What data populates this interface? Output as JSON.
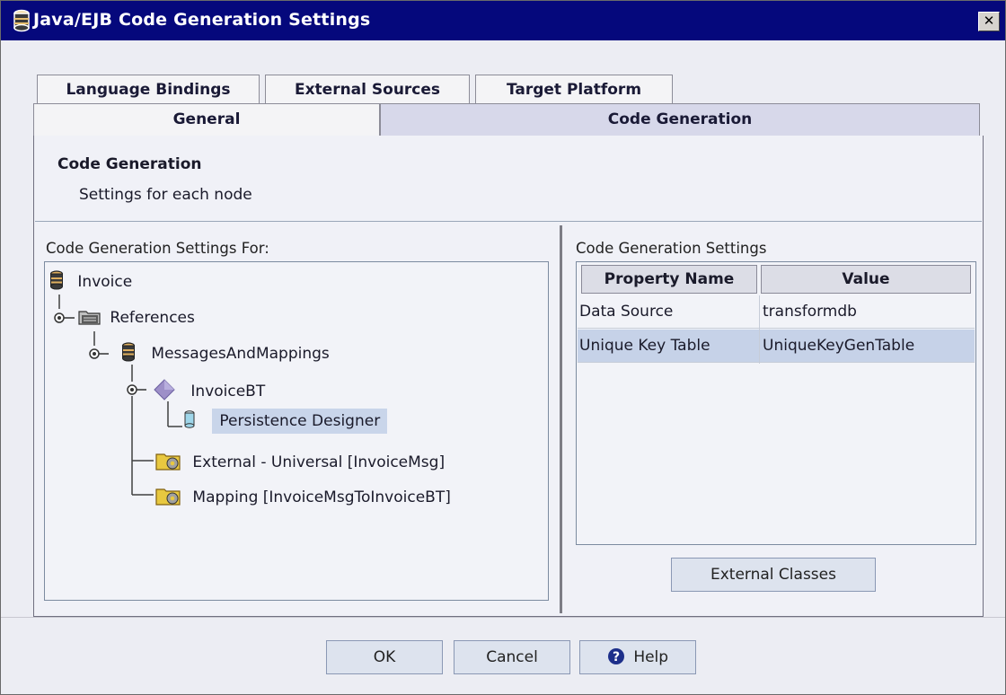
{
  "window": {
    "title": "Java/EJB Code Generation Settings",
    "close_glyph": "✕"
  },
  "tabs": {
    "row_back": [
      {
        "label": "Language Bindings"
      },
      {
        "label": "External Sources"
      },
      {
        "label": "Target Platform"
      }
    ],
    "row_front": [
      {
        "label": "General",
        "active": false
      },
      {
        "label": "Code Generation",
        "active": true
      }
    ]
  },
  "header": {
    "title": "Code Generation",
    "subtitle": "Settings for each node"
  },
  "tree_panel": {
    "label": "Code Generation Settings For:",
    "items": [
      {
        "label": "Invoice",
        "icon": "database-icon"
      },
      {
        "label": "References",
        "icon": "folder-icon"
      },
      {
        "label": "MessagesAndMappings",
        "icon": "database-icon"
      },
      {
        "label": "InvoiceBT",
        "icon": "diamond-icon"
      },
      {
        "label": "Persistence Designer",
        "icon": "cylinder-icon",
        "selected": true
      },
      {
        "label": "External - Universal [InvoiceMsg]",
        "icon": "folder-gear-icon"
      },
      {
        "label": "Mapping [InvoiceMsgToInvoiceBT]",
        "icon": "folder-gear-icon"
      }
    ]
  },
  "settings_panel": {
    "label": "Code Generation Settings",
    "columns": [
      "Property Name",
      "Value"
    ],
    "rows": [
      {
        "property": "Data Source",
        "value": "transformdb",
        "selected": false
      },
      {
        "property": "Unique Key Table",
        "value": "UniqueKeyGenTable",
        "selected": true
      }
    ],
    "external_classes_label": "External Classes"
  },
  "footer": {
    "ok_label": "OK",
    "cancel_label": "Cancel",
    "help_label": "Help"
  },
  "colors": {
    "titlebar": "#05087c",
    "selection": "#c9d5ea",
    "active_tab": "#d7d8ea"
  }
}
